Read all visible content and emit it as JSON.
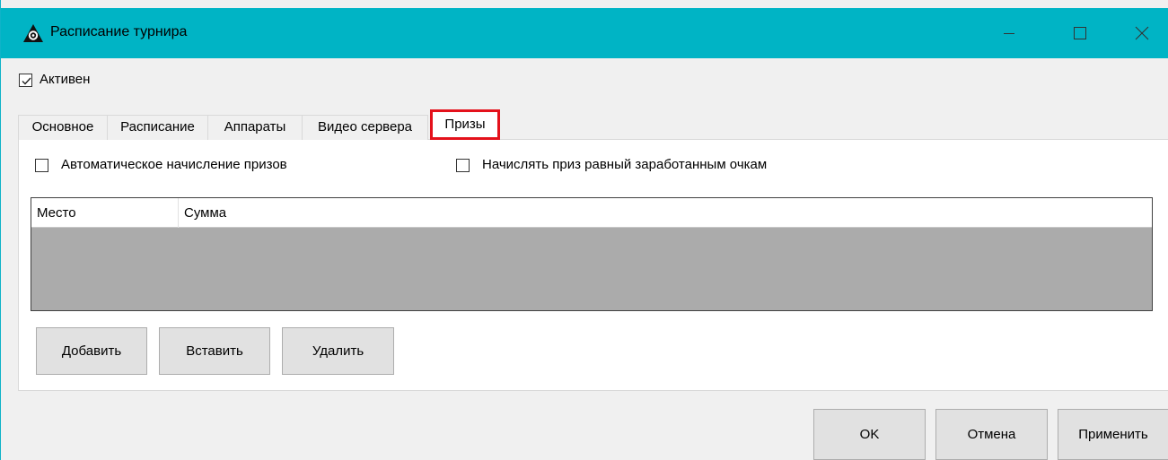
{
  "window": {
    "title": "Расписание турнира",
    "icon": "tournament-app-icon",
    "title_bar_color": "#00b4c5",
    "controls": [
      "minimize-icon",
      "maximize-icon",
      "close-icon"
    ]
  },
  "active": {
    "label": "Активен",
    "checked": true
  },
  "tabs": [
    {
      "label": "Основное",
      "selected": false
    },
    {
      "label": "Расписание",
      "selected": false
    },
    {
      "label": "Аппараты",
      "selected": false
    },
    {
      "label": "Видео сервера",
      "selected": false
    },
    {
      "label": "Призы",
      "selected": true,
      "highlight_color": "#e4111b"
    }
  ],
  "prizes": {
    "auto_label": "Автоматическое начисление призов",
    "auto_checked": false,
    "equal_label": "Начислять приз равный заработанным очкам",
    "equal_checked": false,
    "grid": {
      "columns": [
        "Место",
        "Сумма"
      ],
      "rows": []
    },
    "buttons": {
      "add": "Добавить",
      "insert": "Вставить",
      "delete": "Удалить"
    }
  },
  "footer": {
    "ok": "OK",
    "cancel": "Отмена",
    "apply": "Применить"
  }
}
